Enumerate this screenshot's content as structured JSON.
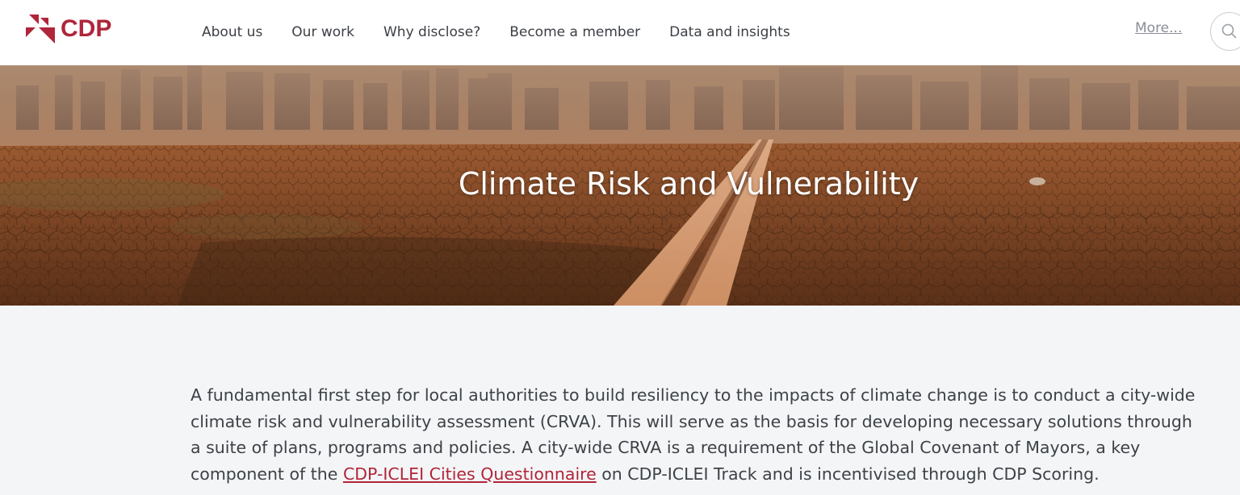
{
  "brand": {
    "name": "CDP",
    "color": "#b0253a"
  },
  "nav": {
    "items": [
      {
        "label": "About us"
      },
      {
        "label": "Our work"
      },
      {
        "label": "Why disclose?"
      },
      {
        "label": "Become a member"
      },
      {
        "label": "Data and insights"
      }
    ],
    "more_label": "More...",
    "search_icon": "search-icon"
  },
  "hero": {
    "title": "Climate Risk and Vulnerability"
  },
  "body": {
    "paragraph_before_link": "A fundamental first step for local authorities to build resiliency to the impacts of climate change is to conduct a city-wide climate risk and vulnerability assessment (CRVA). This will serve as the basis for developing necessary solutions through a suite of plans, programs and policies. A city-wide CRVA is a requirement of the Global Covenant of Mayors, a key component of the ",
    "link_text": "CDP-ICLEI Cities Questionnaire",
    "paragraph_after_link": " on CDP-ICLEI Track and is incentivised through CDP Scoring."
  }
}
